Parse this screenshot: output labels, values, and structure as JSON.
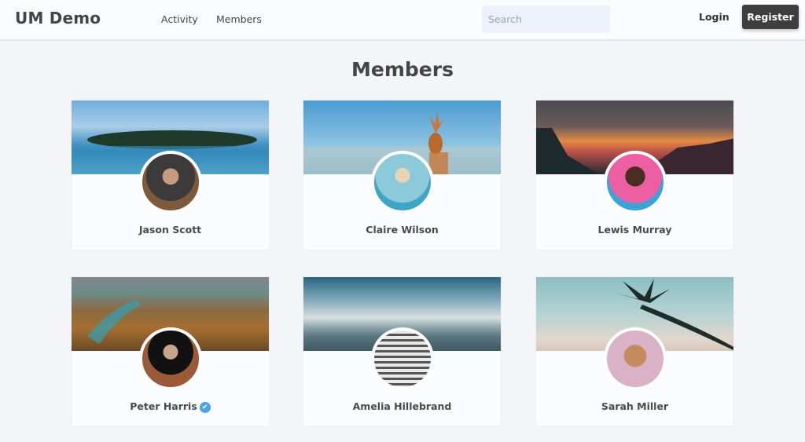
{
  "navbar": {
    "brand": "UM Demo",
    "links": [
      {
        "label": "Activity"
      },
      {
        "label": "Members"
      }
    ],
    "search_placeholder": "Search",
    "search_value": "",
    "login_label": "Login",
    "register_label": "Register"
  },
  "page": {
    "title": "Members"
  },
  "members": [
    {
      "name": "Jason Scott",
      "verified": false,
      "cover": "island-icon",
      "avatar": "jason-avatar"
    },
    {
      "name": "Claire Wilson",
      "verified": false,
      "cover": "pineapple-beach",
      "avatar": "claire-avatar"
    },
    {
      "name": "Lewis Murray",
      "verified": false,
      "cover": "mountain-sunset",
      "avatar": "lewis-avatar"
    },
    {
      "name": "Peter Harris",
      "verified": true,
      "verified_icon": "✔",
      "cover": "canyon",
      "avatar": "peter-avatar"
    },
    {
      "name": "Amelia Hillebrand",
      "verified": false,
      "cover": "mountain-lake",
      "avatar": "amelia-avatar"
    },
    {
      "name": "Sarah Miller",
      "verified": false,
      "cover": "palm-tree",
      "avatar": "sarah-avatar"
    }
  ],
  "colors": {
    "background": "#f3f5f9",
    "card": "#fbfcfe",
    "register_button": "#3e3e3e",
    "search_bg": "#edf1fb",
    "verified_badge": "#4aa3e3"
  }
}
